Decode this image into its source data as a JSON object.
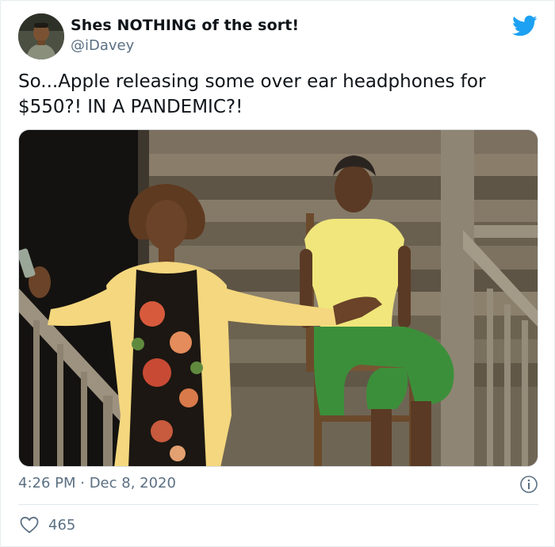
{
  "tweet": {
    "display_name": "Shes NOTHING of the sort!",
    "handle": "@iDavey",
    "text": "So...Apple releasing some over ear headphones for $550?! IN A PANDEMIC?!",
    "timestamp": "4:26 PM · Dec 8, 2020",
    "likes": "465"
  },
  "icons": {
    "brand": "twitter-bird-icon",
    "info": "info-icon",
    "like": "heart-icon"
  },
  "colors": {
    "twitter_blue": "#1da1f2",
    "secondary_text": "#5b7083",
    "primary_text": "#0f1419"
  }
}
